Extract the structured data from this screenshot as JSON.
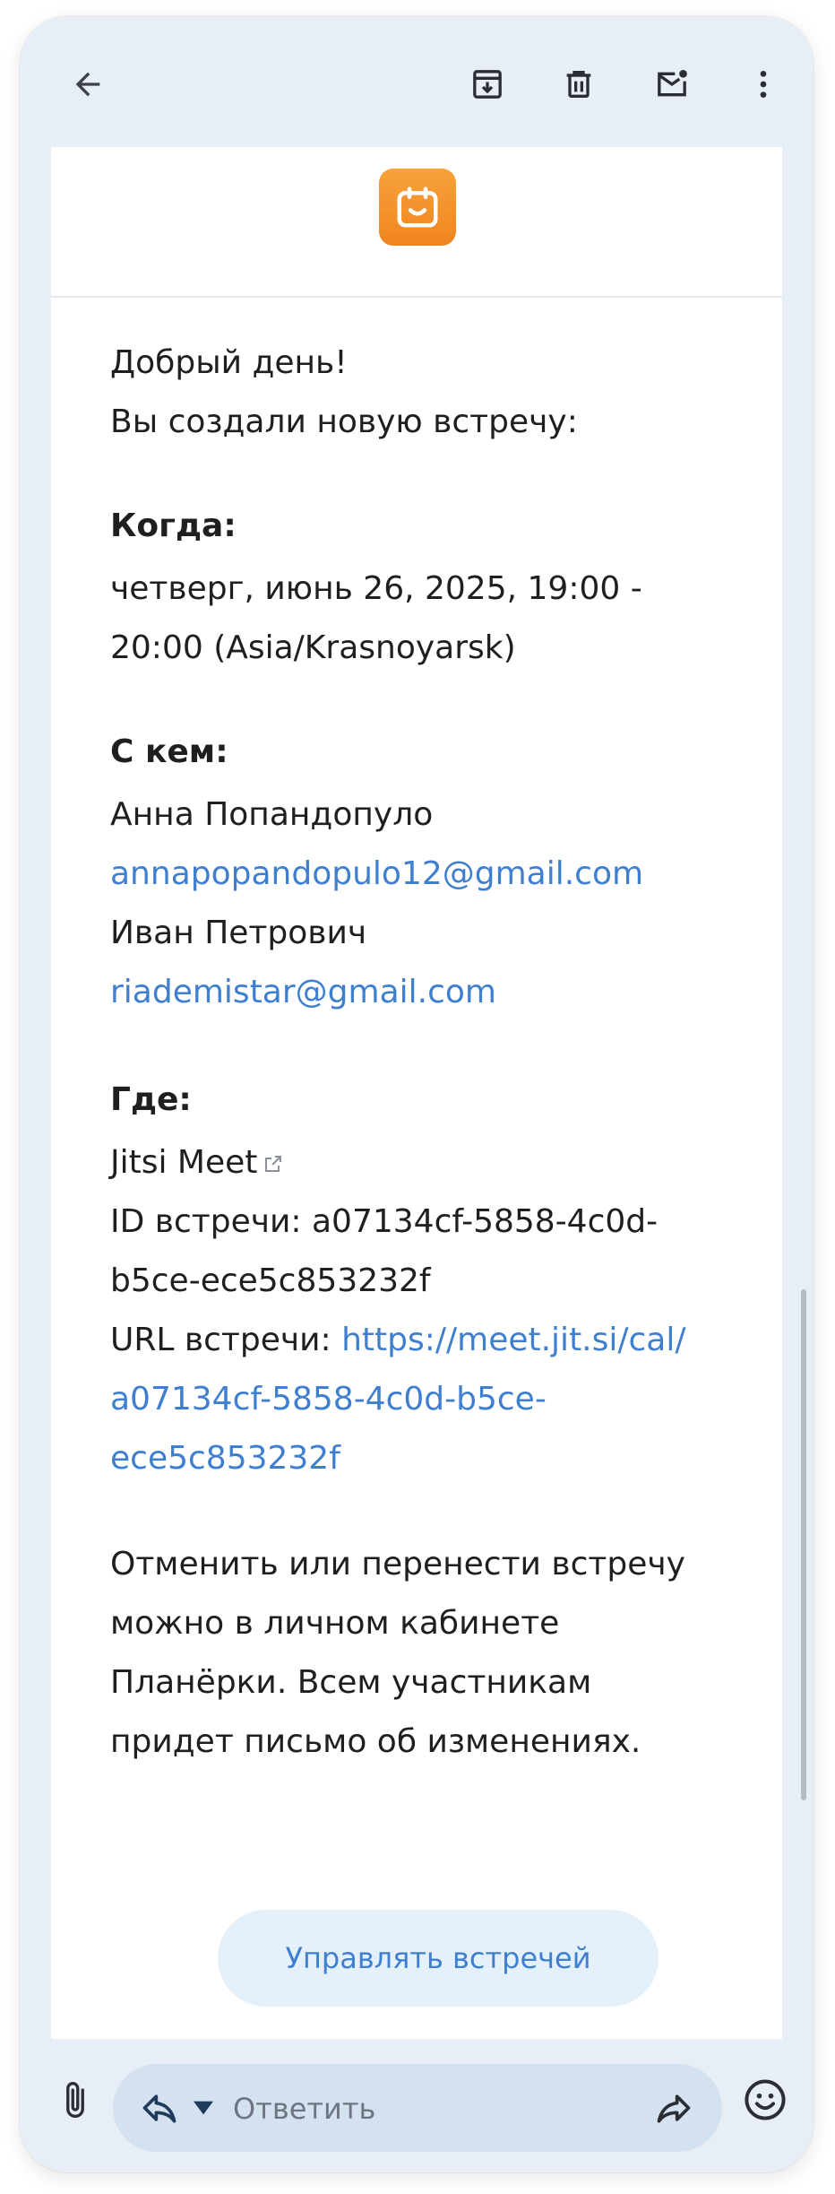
{
  "greeting": "Добрый день!",
  "intro": "Вы создали новую встречу:",
  "when": {
    "heading": "Когда:",
    "line1": "четверг, июнь 26, 2025, 19:00 -",
    "line2": "20:00 (Asia/Krasnoyarsk)"
  },
  "with": {
    "heading": "С кем:",
    "participants": [
      {
        "name": "Анна Попандопуло",
        "email": "annapopandopulo12@gmail.com"
      },
      {
        "name": "Иван Петрович",
        "email": "riademistar@gmail.com"
      }
    ]
  },
  "where": {
    "heading": "Где:",
    "service": "Jitsi Meet",
    "meeting_id_label": "ID встречи: a07134cf-5858-4c0d-",
    "meeting_id_cont": "b5ce-ece5c853232f",
    "url_label": "URL встречи: ",
    "url_part1": "https://meet.jit.si/cal/",
    "url_part2": "a07134cf-5858-4c0d-b5ce-",
    "url_part3": "ece5c853232f"
  },
  "notice": {
    "line1": "Отменить или перенести встречу",
    "line2": "можно в личном кабинете",
    "line3": "Планёрки. Всем участникам",
    "line4": "придет письмо об изменениях."
  },
  "manage_button": "Управлять встречей",
  "reply": {
    "placeholder": "Ответить"
  },
  "colors": {
    "link": "#3f7fcf",
    "logo": "#f08420",
    "button_bg": "#e4f0fa"
  },
  "icons": [
    "back-arrow-icon",
    "archive-icon",
    "trash-icon",
    "mark-unread-icon",
    "more-vert-icon",
    "calendar-logo-icon",
    "external-link-icon",
    "attach-icon",
    "reply-icon",
    "dropdown-icon",
    "forward-icon",
    "emoji-icon"
  ]
}
